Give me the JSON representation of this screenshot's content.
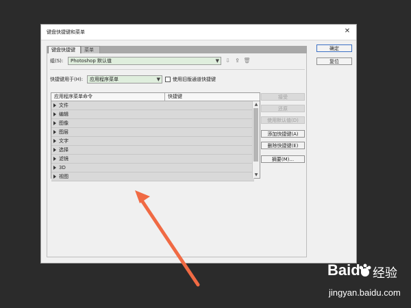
{
  "dialog": {
    "title": "键盘快捷键和菜单",
    "close_glyph": "✕"
  },
  "tabs": [
    {
      "label": "键盘快捷键",
      "active": true
    },
    {
      "label": "菜单",
      "active": false
    }
  ],
  "group": {
    "label": "组(S):",
    "value": "Photoshop 默认值"
  },
  "shortcuts_for": {
    "label": "快捷键用于(H):",
    "value": "应用程序菜单",
    "legacy_checkbox_label": "使用旧版通道快捷键",
    "legacy_checked": false
  },
  "table": {
    "columns": [
      "应用程序菜单命令",
      "快捷键"
    ],
    "rows": [
      "文件",
      "编辑",
      "图像",
      "图层",
      "文字",
      "选择",
      "滤镜",
      "3D",
      "视图"
    ]
  },
  "side_buttons": [
    {
      "label": "接受",
      "enabled": false
    },
    {
      "label": "还原",
      "enabled": false
    },
    {
      "label": "使用默认值(D)",
      "enabled": false
    },
    {
      "label": "添加快捷键(A)",
      "enabled": true
    },
    {
      "label": "删除快捷键(E)",
      "enabled": true
    },
    {
      "label": "摘要(M)...",
      "enabled": true
    }
  ],
  "main_buttons": {
    "ok": "确定",
    "reset": "复位"
  },
  "colors": {
    "arrow": "#f06a44",
    "select_bg": "#dfeedd",
    "background": "#2b2b2b"
  },
  "watermark": {
    "brand": "Baidu",
    "chinese": "经验",
    "url": "jingyan.baidu.com"
  }
}
